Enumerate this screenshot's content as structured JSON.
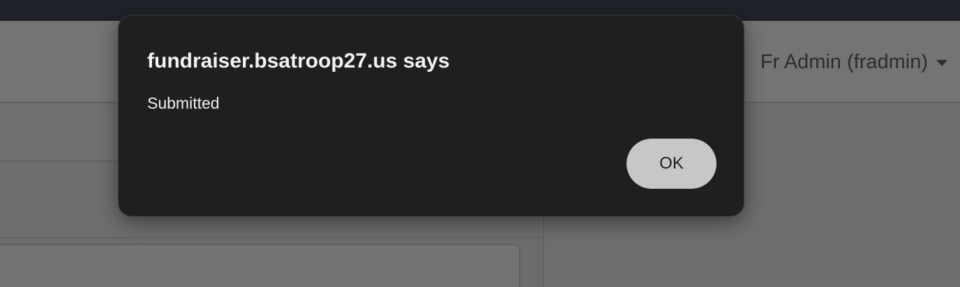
{
  "header": {
    "user_menu_label": "Fr Admin (fradmin)"
  },
  "dialog": {
    "title": "fundraiser.bsatroop27.us says",
    "message": "Submitted",
    "ok_label": "OK"
  },
  "colors": {
    "dialog_background": "#1f1f1f",
    "ok_button_background": "#c7c7c7",
    "overlay_dim": "#6b6b6b"
  },
  "icons": {
    "user_menu_caret": "chevron-down-icon"
  }
}
